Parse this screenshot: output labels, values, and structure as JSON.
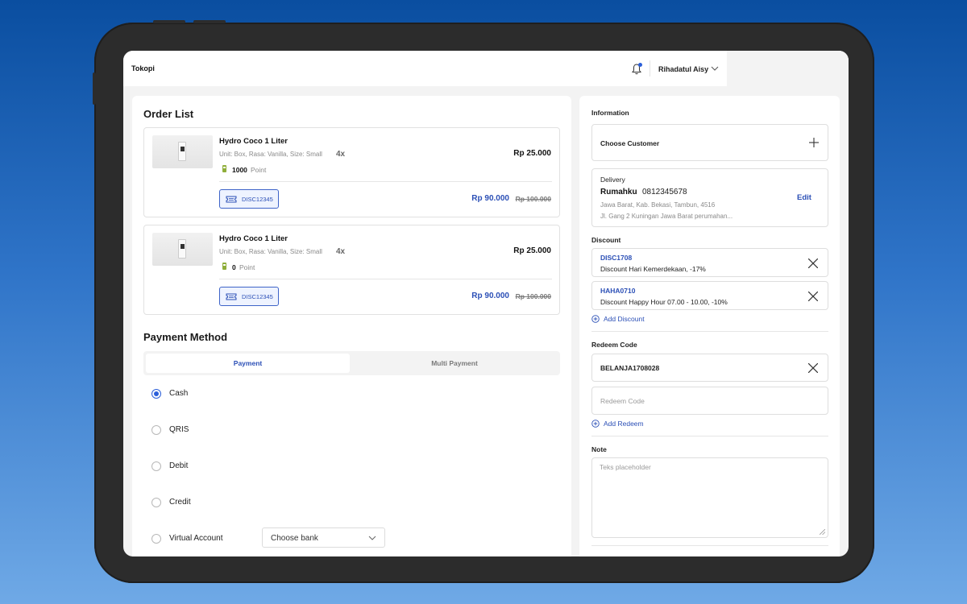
{
  "app": {
    "name": "Tokopi"
  },
  "header": {
    "user_name": "Rihadatul Aisy"
  },
  "order_list": {
    "title": "Order List",
    "items": [
      {
        "name": "Hydro Coco 1 Liter",
        "spec": "Unit: Box, Rasa: Vanilla, Size: Small",
        "qty": "4x",
        "points": "1000",
        "points_label": "Point",
        "price": "Rp 25.000",
        "discount_code": "DISC12345",
        "final_price": "Rp 90.000",
        "original_price": "Rp 100.000"
      },
      {
        "name": "Hydro Coco 1 Liter",
        "spec": "Unit: Box, Rasa: Vanilla, Size: Small",
        "qty": "4x",
        "points": "0",
        "points_label": "Point",
        "price": "Rp 25.000",
        "discount_code": "DISC12345",
        "final_price": "Rp 90.000",
        "original_price": "Rp 100.000"
      }
    ]
  },
  "payment": {
    "title": "Payment Method",
    "tabs": [
      {
        "label": "Payment",
        "active": true
      },
      {
        "label": "Multi Payment",
        "active": false
      }
    ],
    "methods": [
      {
        "label": "Cash",
        "selected": true
      },
      {
        "label": "QRIS",
        "selected": false
      },
      {
        "label": "Debit",
        "selected": false
      },
      {
        "label": "Credit",
        "selected": false
      },
      {
        "label": "Virtual Account",
        "selected": false
      }
    ],
    "bank_select": {
      "value": "Choose bank"
    }
  },
  "information": {
    "title": "Information",
    "choose_customer": "Choose Customer",
    "delivery": {
      "label": "Delivery",
      "name": "Rumahku",
      "phone": "0812345678",
      "edit_label": "Edit",
      "address_line1": "Jawa Barat, Kab. Bekasi, Tambun, 4516",
      "address_line2": "Jl. Gang 2 Kuningan Jawa Barat perumahan..."
    }
  },
  "discount": {
    "title": "Discount",
    "items": [
      {
        "code": "DISC1708",
        "desc": "Discount Hari Kemerdekaan, -17%"
      },
      {
        "code": "HAHA0710",
        "desc": "Discount Happy Hour 07.00 - 10.00, -10%"
      }
    ],
    "add_label": "Add Discount"
  },
  "redeem": {
    "title": "Redeem Code",
    "applied_code": "BELANJA1708028",
    "placeholder": "Redeem Code",
    "add_label": "Add Redeem"
  },
  "note": {
    "title": "Note",
    "placeholder": "Teks placeholder"
  },
  "colors": {
    "accent": "#2b4fb6",
    "radio_selected": "#2b5fd9",
    "background_gradient_top": "#0a4ea0",
    "background_gradient_bottom": "#6fa9e6",
    "device_frame": "#2c2c2c"
  }
}
